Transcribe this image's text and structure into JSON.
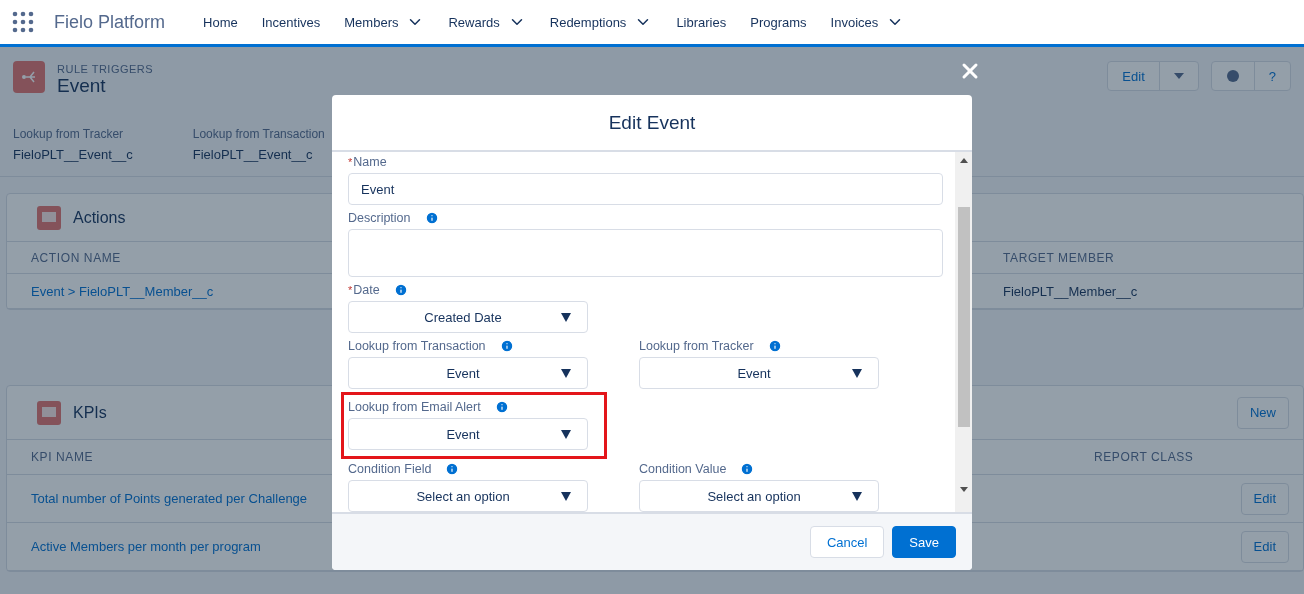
{
  "app": {
    "title": "Fielo Platform",
    "nav": [
      {
        "label": "Home",
        "dropdown": false
      },
      {
        "label": "Incentives",
        "dropdown": false
      },
      {
        "label": "Members",
        "dropdown": true
      },
      {
        "label": "Rewards",
        "dropdown": true
      },
      {
        "label": "Redemptions",
        "dropdown": true
      },
      {
        "label": "Libraries",
        "dropdown": false
      },
      {
        "label": "Programs",
        "dropdown": false
      },
      {
        "label": "Invoices",
        "dropdown": true
      }
    ]
  },
  "record": {
    "object_label": "RULE TRIGGERS",
    "title": "Event",
    "edit_button": "Edit",
    "help_button": "?",
    "fields": [
      {
        "label": "Lookup from Tracker",
        "value": "FieloPLT__Event__c"
      },
      {
        "label": "Lookup from Transaction",
        "value": "FieloPLT__Event__c"
      }
    ]
  },
  "actions": {
    "title": "Actions",
    "columns": [
      "ACTION NAME",
      "TARGET MEMBER"
    ],
    "rows": [
      [
        "Event > FieloPLT__Member__c",
        "FieloPLT__Member__c"
      ]
    ]
  },
  "kpis": {
    "title": "KPIs",
    "new_button": "New",
    "columns": [
      "KPI NAME",
      "REPORT CLASS"
    ],
    "rows": [
      {
        "name": "Total number of Points generated per Challenge",
        "action": "Edit"
      },
      {
        "name": "Active Members per month per program",
        "action": "Edit"
      }
    ]
  },
  "modal": {
    "title": "Edit Event",
    "cancel": "Cancel",
    "save": "Save",
    "rows": [
      [
        {
          "kind": "text",
          "label": "Name",
          "required_mark": "*",
          "info": false,
          "value": "Event",
          "highlighted": false
        }
      ],
      [
        {
          "kind": "textarea",
          "label": "Description",
          "info": true,
          "highlighted": false
        }
      ],
      [
        {
          "kind": "select",
          "label": "Date",
          "required_mark": "*",
          "info": true,
          "value": "Created Date",
          "highlighted": false
        }
      ],
      [
        {
          "kind": "select",
          "label": "Lookup from Transaction",
          "info": true,
          "value": "Event",
          "highlighted": false
        },
        {
          "kind": "select",
          "label": "Lookup from Tracker",
          "info": true,
          "value": "Event",
          "highlighted": false
        }
      ],
      [
        {
          "kind": "select",
          "label": "Lookup from Email Alert",
          "info": true,
          "value": "Event",
          "highlighted": true
        }
      ],
      [
        {
          "kind": "select",
          "label": "Condition Field",
          "info": true,
          "value": "Select an option",
          "highlighted": false
        },
        {
          "kind": "select",
          "label": "Condition Value",
          "info": true,
          "value": "Select an option",
          "highlighted": false
        }
      ]
    ]
  }
}
